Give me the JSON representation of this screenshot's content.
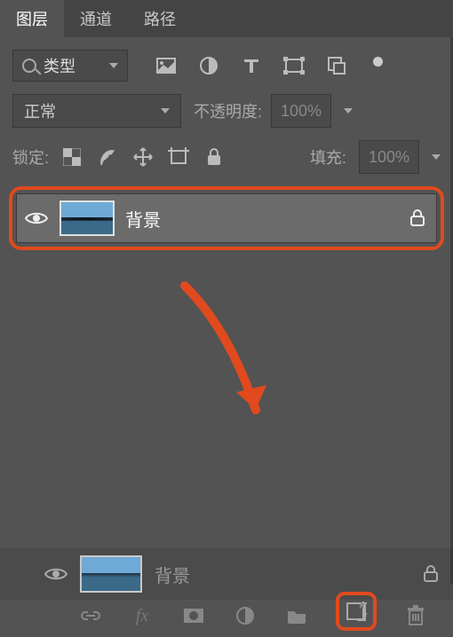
{
  "tabs": {
    "layers": "图层",
    "channels": "通道",
    "paths": "路径"
  },
  "filter": {
    "type_label": "类型"
  },
  "blend": {
    "mode": "正常",
    "opacity_label": "不透明度:",
    "opacity_value": "100%"
  },
  "lock": {
    "label": "锁定:",
    "fill_label": "填充:",
    "fill_value": "100%"
  },
  "layer": {
    "name": "背景"
  }
}
